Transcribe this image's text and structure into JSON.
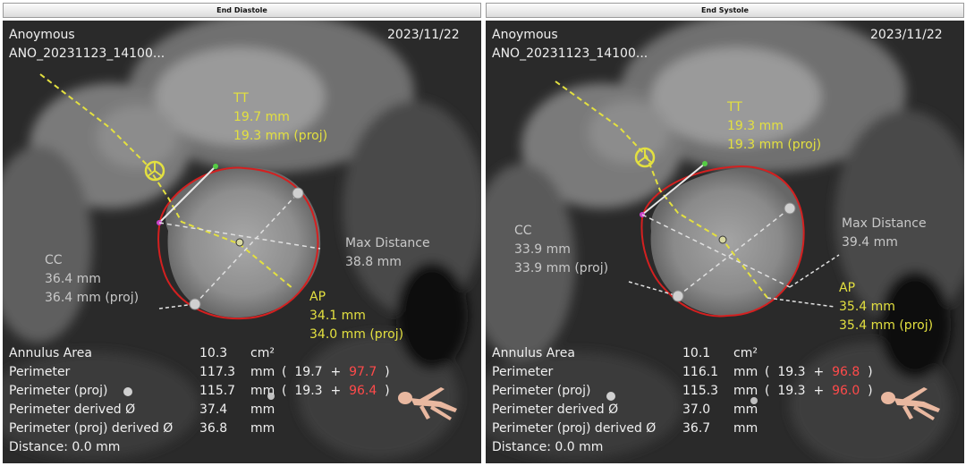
{
  "panels": [
    {
      "title": "End Diastole",
      "patient": "Anoymous",
      "series": "ANO_20231123_14100...",
      "date": "2023/11/22",
      "tt": {
        "name": "TT",
        "v1": "19.7 mm",
        "v2": "19.3 mm (proj)"
      },
      "cc": {
        "name": "CC",
        "v1": "36.4 mm",
        "v2": "36.4 mm (proj)"
      },
      "ap": {
        "name": "AP",
        "v1": "34.1 mm",
        "v2": "34.0 mm (proj)"
      },
      "maxd": {
        "name": "Max Distance",
        "v1": "38.8 mm"
      },
      "rows": [
        {
          "label": "Annulus Area",
          "value": "10.3",
          "unit": "cm²"
        },
        {
          "label": "Perimeter",
          "value": "117.3",
          "unit": "mm",
          "open": "(",
          "a": "19.7",
          "plus": "+",
          "b": "97.7",
          "close": ")"
        },
        {
          "label": "Perimeter (proj)",
          "value": "115.7",
          "unit": "mm",
          "open": "(",
          "a": "19.3",
          "plus": "+",
          "b": "96.4",
          "close": ")"
        },
        {
          "label": "Perimeter derived Ø",
          "value": "37.4",
          "unit": "mm"
        },
        {
          "label": "Perimeter (proj) derived Ø",
          "value": "36.8",
          "unit": "mm"
        },
        {
          "label": "Distance: 0.0 mm"
        }
      ],
      "colors": {
        "outline": "#d42020",
        "guide": "#e3e040",
        "measure": "#ffffff"
      }
    },
    {
      "title": "End Systole",
      "patient": "Anoymous",
      "series": "ANO_20231123_14100...",
      "date": "2023/11/22",
      "tt": {
        "name": "TT",
        "v1": "19.3 mm",
        "v2": "19.3 mm (proj)"
      },
      "cc": {
        "name": "CC",
        "v1": "33.9 mm",
        "v2": "33.9 mm (proj)"
      },
      "ap": {
        "name": "AP",
        "v1": "35.4 mm",
        "v2": "35.4 mm (proj)"
      },
      "maxd": {
        "name": "Max Distance",
        "v1": "39.4 mm"
      },
      "rows": [
        {
          "label": "Annulus Area",
          "value": "10.1",
          "unit": "cm²"
        },
        {
          "label": "Perimeter",
          "value": "116.1",
          "unit": "mm",
          "open": "(",
          "a": "19.3",
          "plus": "+",
          "b": "96.8",
          "close": ")"
        },
        {
          "label": "Perimeter (proj)",
          "value": "115.3",
          "unit": "mm",
          "open": "(",
          "a": "19.3",
          "plus": "+",
          "b": "96.0",
          "close": ")"
        },
        {
          "label": "Perimeter derived Ø",
          "value": "37.0",
          "unit": "mm"
        },
        {
          "label": "Perimeter (proj) derived Ø",
          "value": "36.7",
          "unit": "mm"
        },
        {
          "label": "Distance: 0.0 mm"
        }
      ],
      "colors": {
        "outline": "#d42020",
        "guide": "#e3e040",
        "measure": "#ffffff"
      }
    }
  ]
}
